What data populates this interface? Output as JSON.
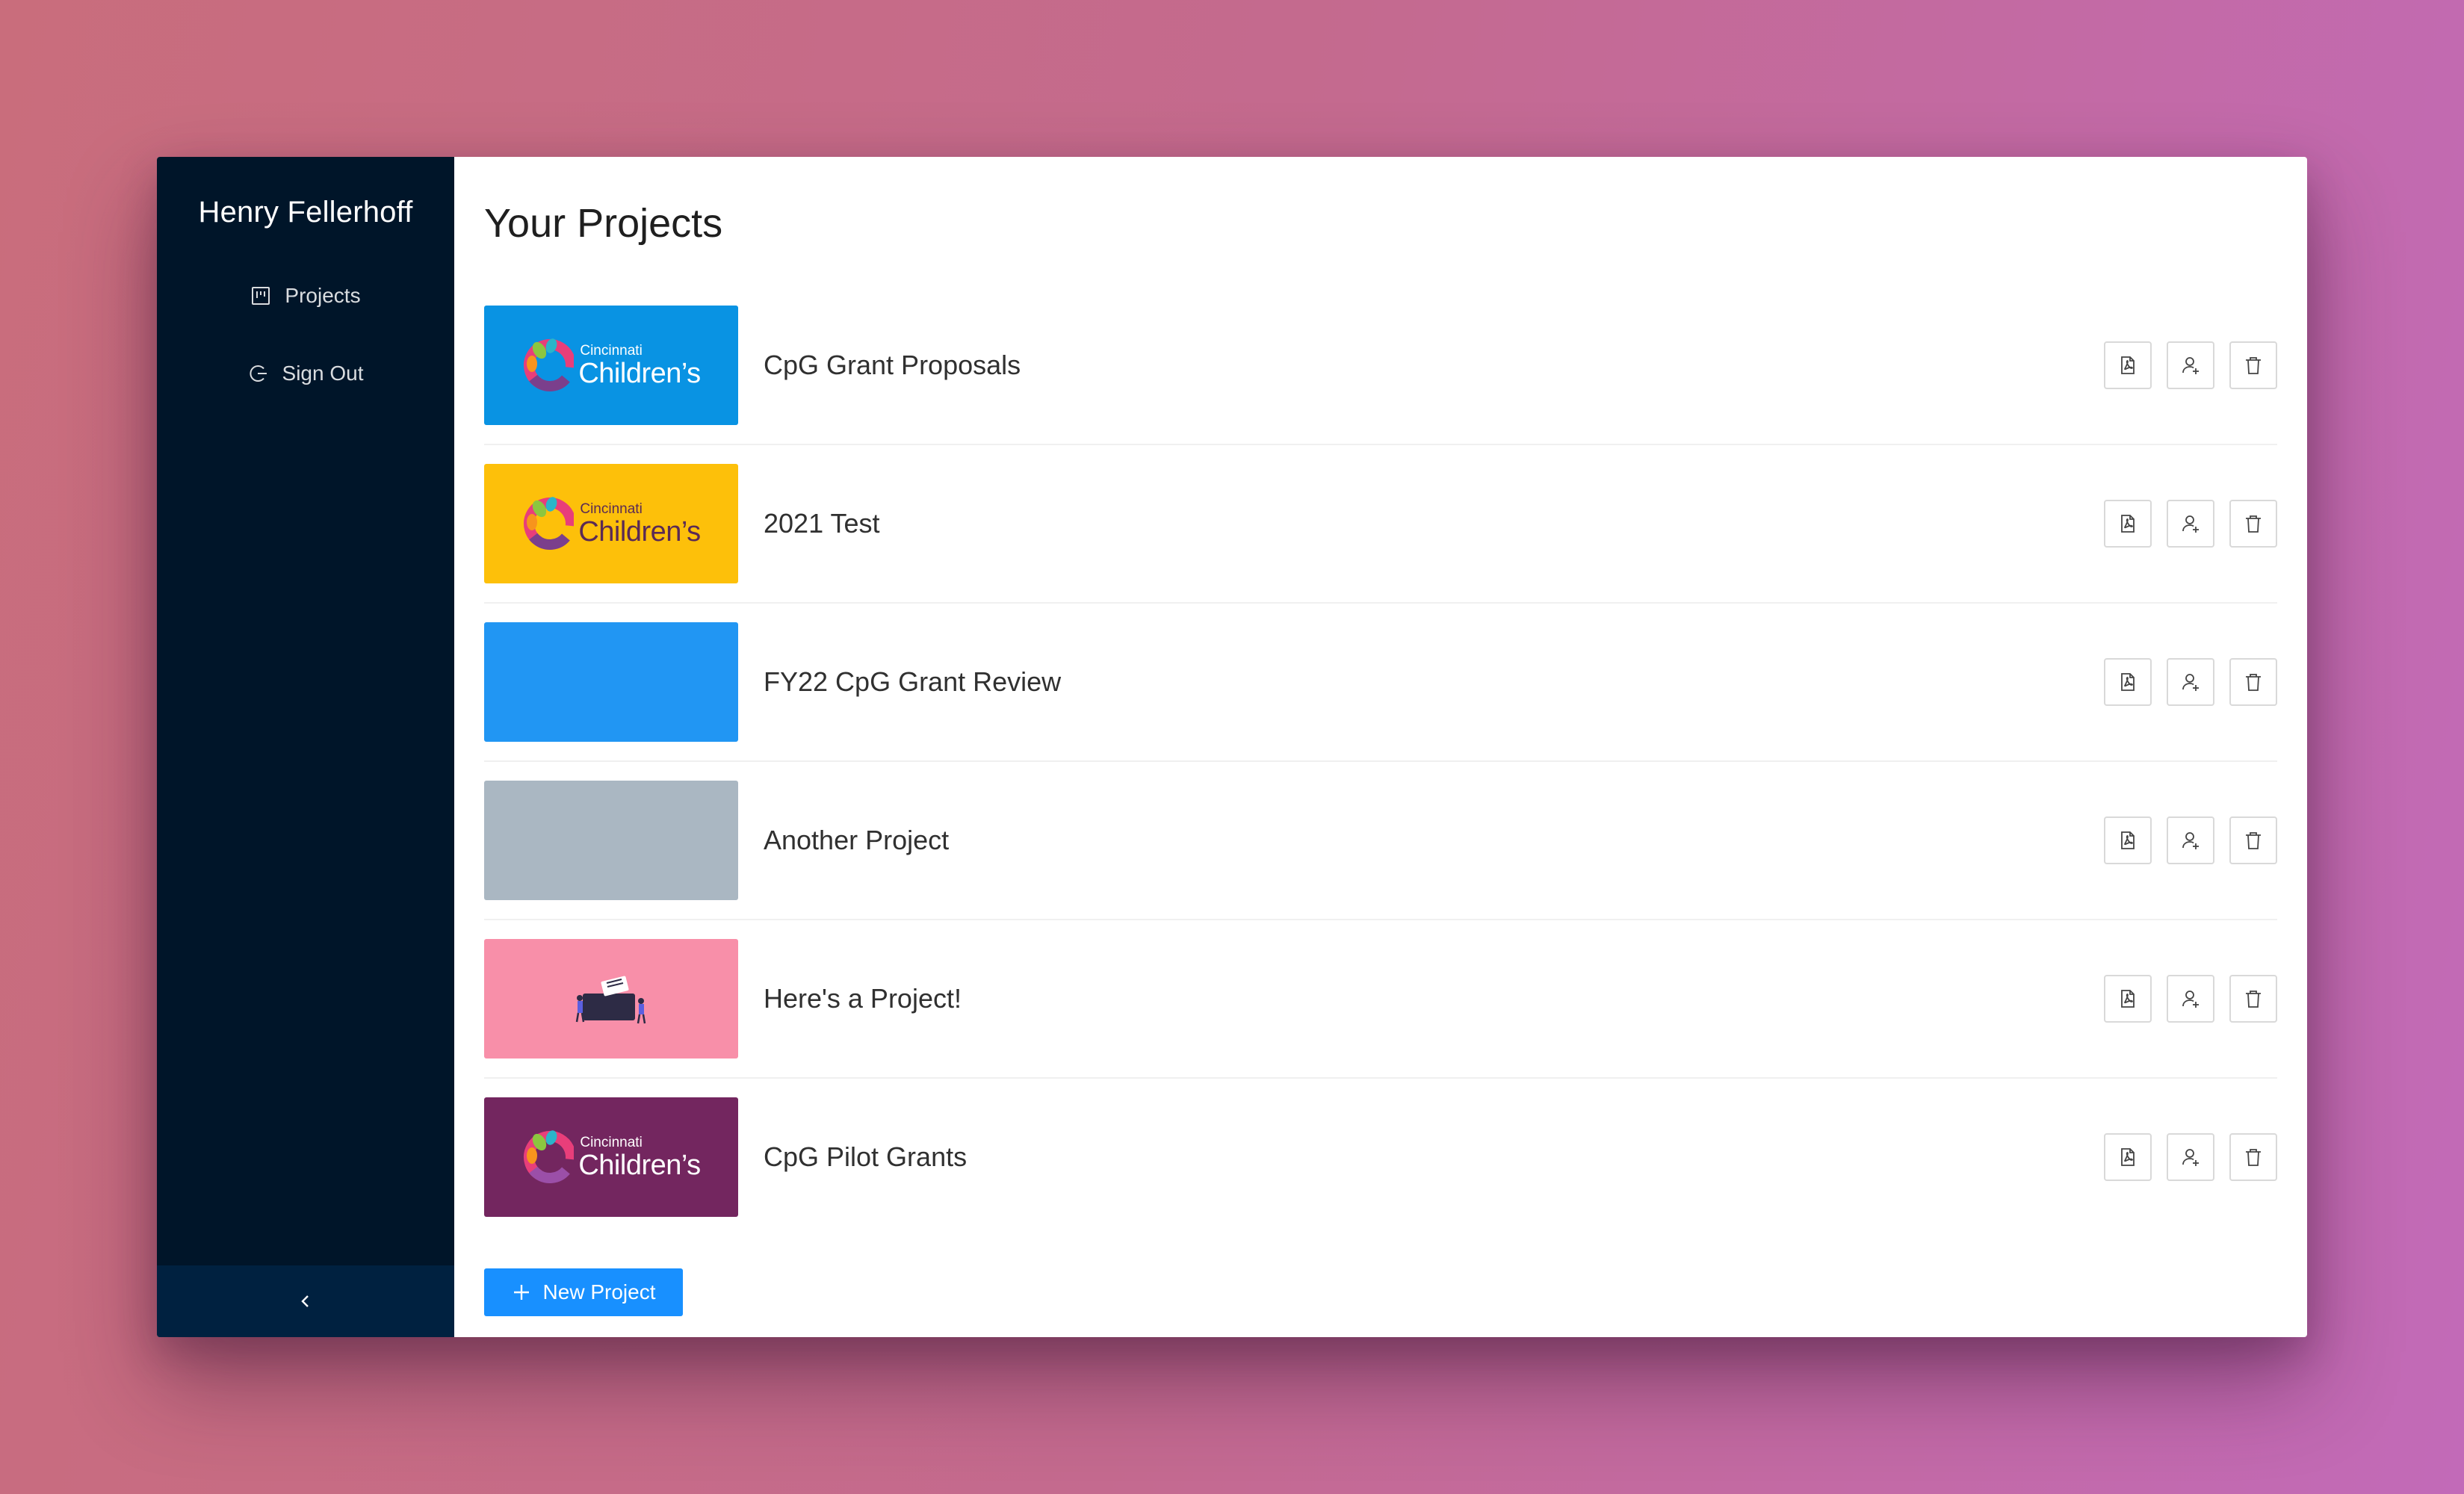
{
  "colors": {
    "sidebar_bg": "#001529",
    "sidebar_footer_bg": "#002140",
    "primary": "#1890ff"
  },
  "sidebar": {
    "user_name": "Henry Fellerhoff",
    "items": [
      {
        "label": "Projects",
        "icon": "project-icon"
      },
      {
        "label": "Sign Out",
        "icon": "logout-icon"
      }
    ],
    "collapse_icon": "chevron-left-icon"
  },
  "main": {
    "title": "Your Projects",
    "projects": [
      {
        "name": "CpG Grant Proposals",
        "thumb_color": "#0993e3",
        "thumb": "logo-light",
        "logo_small": "Cincinnati",
        "logo_big": "Children’s"
      },
      {
        "name": "2021 Test",
        "thumb_color": "#fdc00a",
        "thumb": "logo-dark",
        "logo_small": "Cincinnati",
        "logo_big": "Children’s"
      },
      {
        "name": "FY22 CpG Grant Review",
        "thumb_color": "#2196f3",
        "thumb": "solid"
      },
      {
        "name": "Another Project",
        "thumb_color": "#aab7c2",
        "thumb": "solid"
      },
      {
        "name": "Here's a Project!",
        "thumb_color": "#f88fa9",
        "thumb": "illustration"
      },
      {
        "name": "CpG Pilot Grants",
        "thumb_color": "#73265f",
        "thumb": "logo-light",
        "logo_small": "Cincinnati",
        "logo_big": "Children’s"
      }
    ],
    "row_actions": [
      "file-pdf-icon",
      "user-add-icon",
      "delete-icon"
    ],
    "new_project_label": "New Project"
  }
}
